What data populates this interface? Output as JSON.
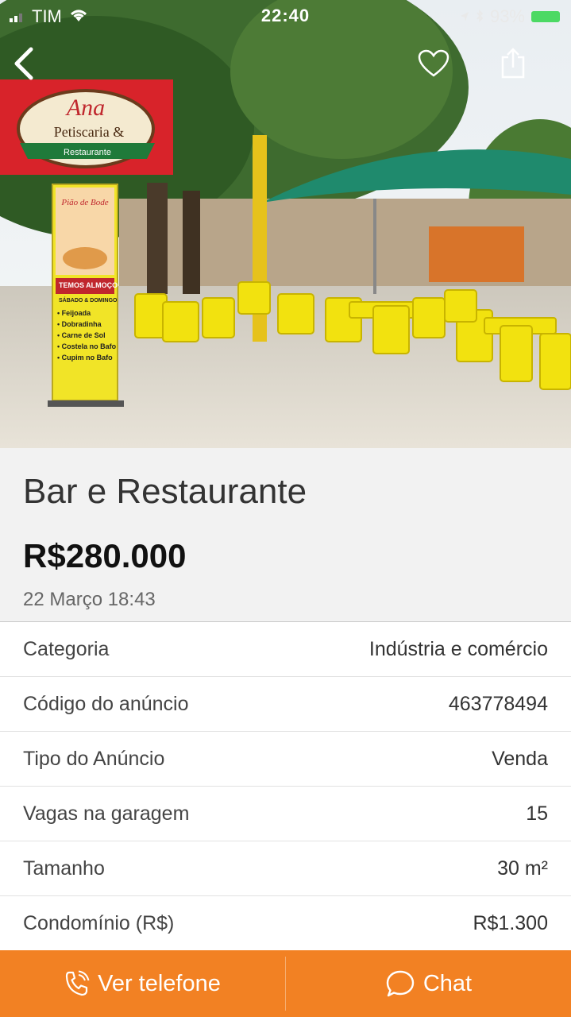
{
  "status_bar": {
    "carrier": "TIM",
    "time": "22:40",
    "battery": "93%"
  },
  "hero": {
    "sign_top": "Ana",
    "sign_line": "Petiscaria &",
    "sign_ribbon": "Restaurante",
    "banner_title": "Pião de Bode",
    "banner_lines": [
      "TEMOS ALMOÇO",
      "SÁBADO & DOMINGO",
      "• Feijoada",
      "• Dobradinha",
      "• Carne de Sol",
      "• Costela no Bafo",
      "• Cupim no Bafo"
    ]
  },
  "listing": {
    "title": "Bar e Restaurante",
    "price": "R$280.000",
    "date": "22 Março 18:43"
  },
  "details": [
    {
      "label": "Categoria",
      "value": "Indústria e comércio"
    },
    {
      "label": "Código do anúncio",
      "value": "463778494"
    },
    {
      "label": "Tipo do Anúncio",
      "value": "Venda"
    },
    {
      "label": "Vagas na garagem",
      "value": "15"
    },
    {
      "label": "Tamanho",
      "value": "30 m²"
    },
    {
      "label": "Condomínio (R$)",
      "value": "R$1.300"
    }
  ],
  "actions": {
    "phone_label": "Ver telefone",
    "chat_label": "Chat"
  },
  "icons": {
    "back": "chevron-left-icon",
    "favorite": "heart-icon",
    "share": "share-icon",
    "phone": "phone-icon",
    "chat": "chat-bubble-icon"
  },
  "colors": {
    "accent": "#f28123",
    "battery": "#4cd964"
  }
}
